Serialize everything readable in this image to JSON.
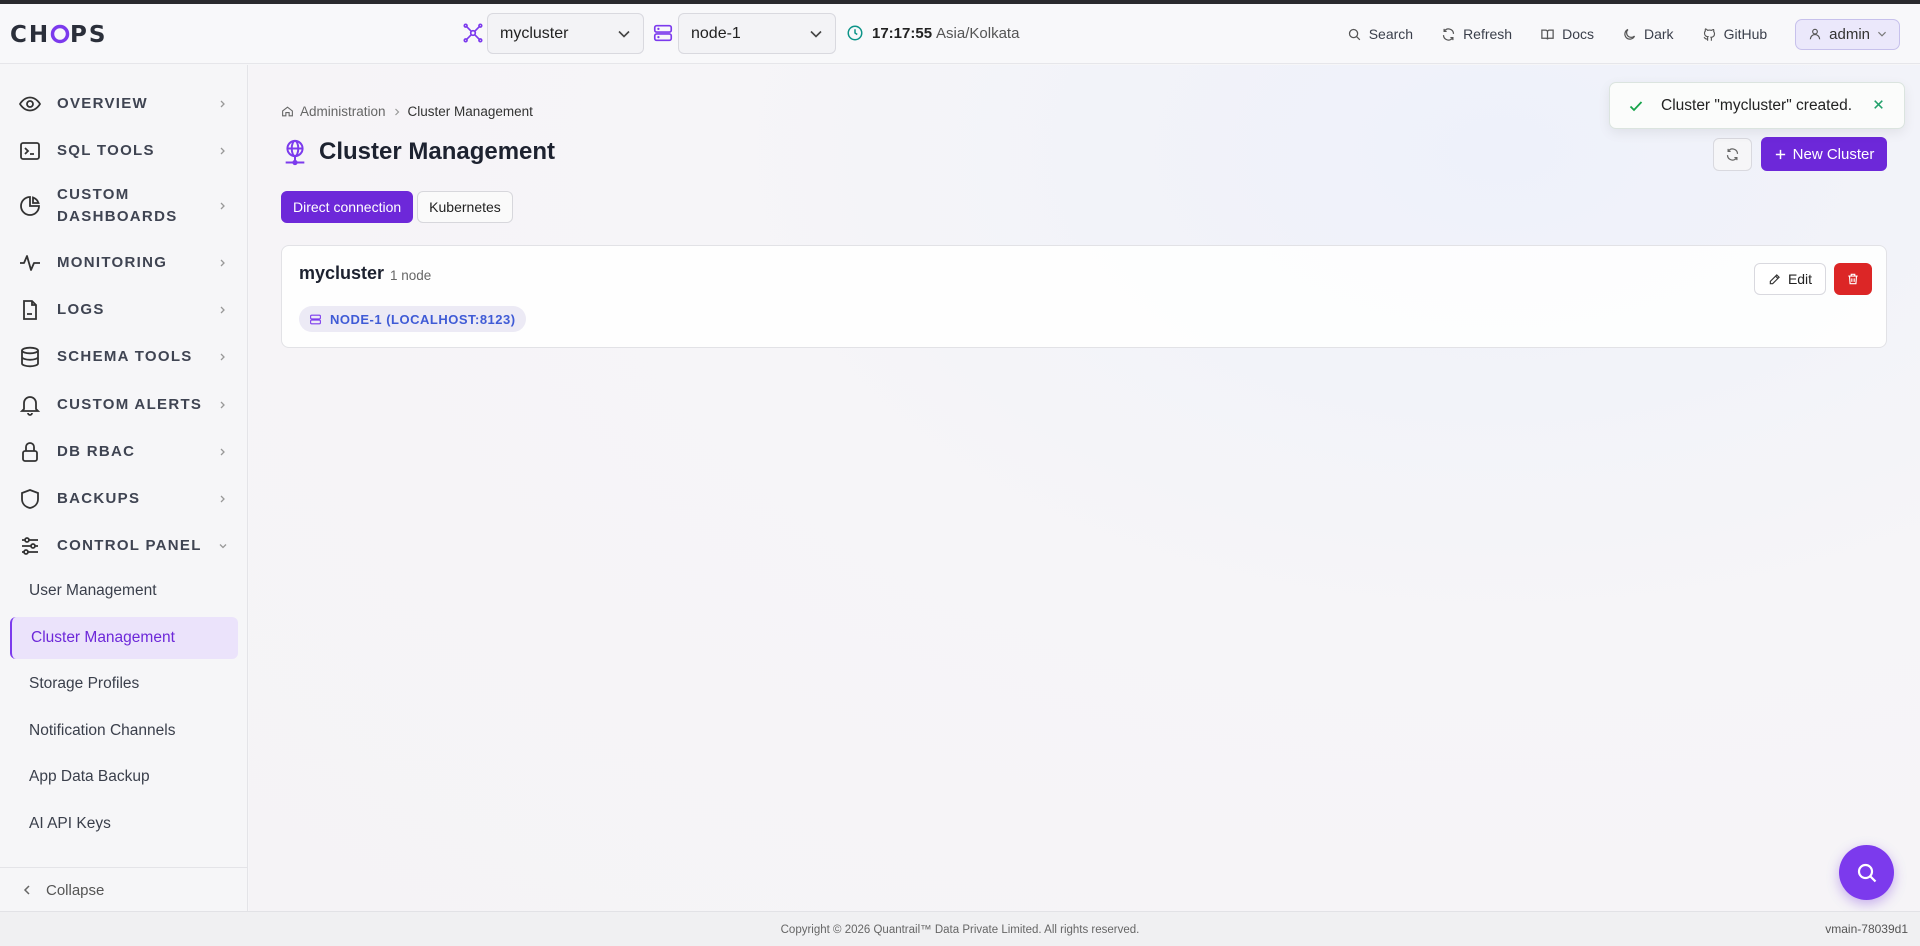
{
  "app": {
    "logo": "CHOPS"
  },
  "header": {
    "cluster_select": "mycluster",
    "node_select": "node-1",
    "time": "17:17:55",
    "timezone": "Asia/Kolkata",
    "links": [
      "Search",
      "Refresh",
      "Docs",
      "Dark",
      "GitHub"
    ],
    "user": "admin"
  },
  "sidebar": {
    "items": [
      {
        "label": "OVERVIEW",
        "icon": "eye-icon"
      },
      {
        "label": "SQL TOOLS",
        "icon": "terminal-icon"
      },
      {
        "label": "CUSTOM DASHBOARDS",
        "icon": "pie-chart-icon"
      },
      {
        "label": "MONITORING",
        "icon": "activity-icon"
      },
      {
        "label": "LOGS",
        "icon": "file-icon"
      },
      {
        "label": "SCHEMA TOOLS",
        "icon": "database-icon"
      },
      {
        "label": "CUSTOM ALERTS",
        "icon": "bell-icon"
      },
      {
        "label": "DB RBAC",
        "icon": "lock-icon"
      },
      {
        "label": "BACKUPS",
        "icon": "shield-icon"
      },
      {
        "label": "CONTROL PANEL",
        "icon": "sliders-icon"
      }
    ],
    "sub_items": [
      "User Management",
      "Cluster Management",
      "Storage Profiles",
      "Notification Channels",
      "App Data Backup",
      "AI API Keys"
    ],
    "collapse_label": "Collapse"
  },
  "main": {
    "breadcrumb": {
      "root": "Administration",
      "current": "Cluster Management"
    },
    "title": "Cluster Management",
    "tabs": [
      "Direct connection",
      "Kubernetes"
    ],
    "new_button": "New Cluster",
    "cluster": {
      "name": "mycluster",
      "count": "1 node",
      "node": "NODE-1 (LOCALHOST:8123)",
      "edit_label": "Edit"
    }
  },
  "toast": {
    "message": "Cluster \"mycluster\" created."
  },
  "footer": {
    "copyright": "Copyright © 2026 Quantrail™ Data Private Limited. All rights reserved.",
    "version": "vmain-78039d1"
  },
  "colors": {
    "accent": "#6d28d9",
    "danger": "#dc2626",
    "node_chip": "#3f5bd6",
    "success": "#16a34a"
  }
}
